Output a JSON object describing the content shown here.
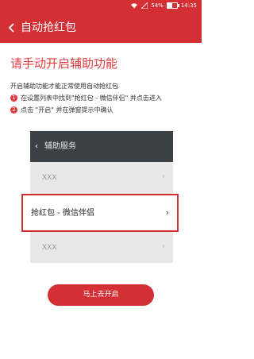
{
  "status_bar": {
    "battery_text": "54%",
    "time": "14:35"
  },
  "app_bar": {
    "title": "自动抢红包"
  },
  "main": {
    "headline": "请手动开启辅助功能",
    "description": "开启辅助功能才能正常使用自动抢红包",
    "steps": [
      {
        "num": "1",
        "text": "在设置列表中找到\"抢红包 - 微信伴侣\" 并点击进入"
      },
      {
        "num": "2",
        "text": "点击 \"开启\" 并在弹窗提示中确认"
      }
    ]
  },
  "illustration": {
    "header_chevron": "‹",
    "header_title": "辅助服务",
    "rows": [
      {
        "label": "XXX",
        "arrow": "›"
      },
      {
        "label": "抢红包 - 微信伴侣",
        "arrow": "›"
      },
      {
        "label": "XXX",
        "arrow": "›"
      }
    ]
  },
  "cta_label": "马上去开启"
}
